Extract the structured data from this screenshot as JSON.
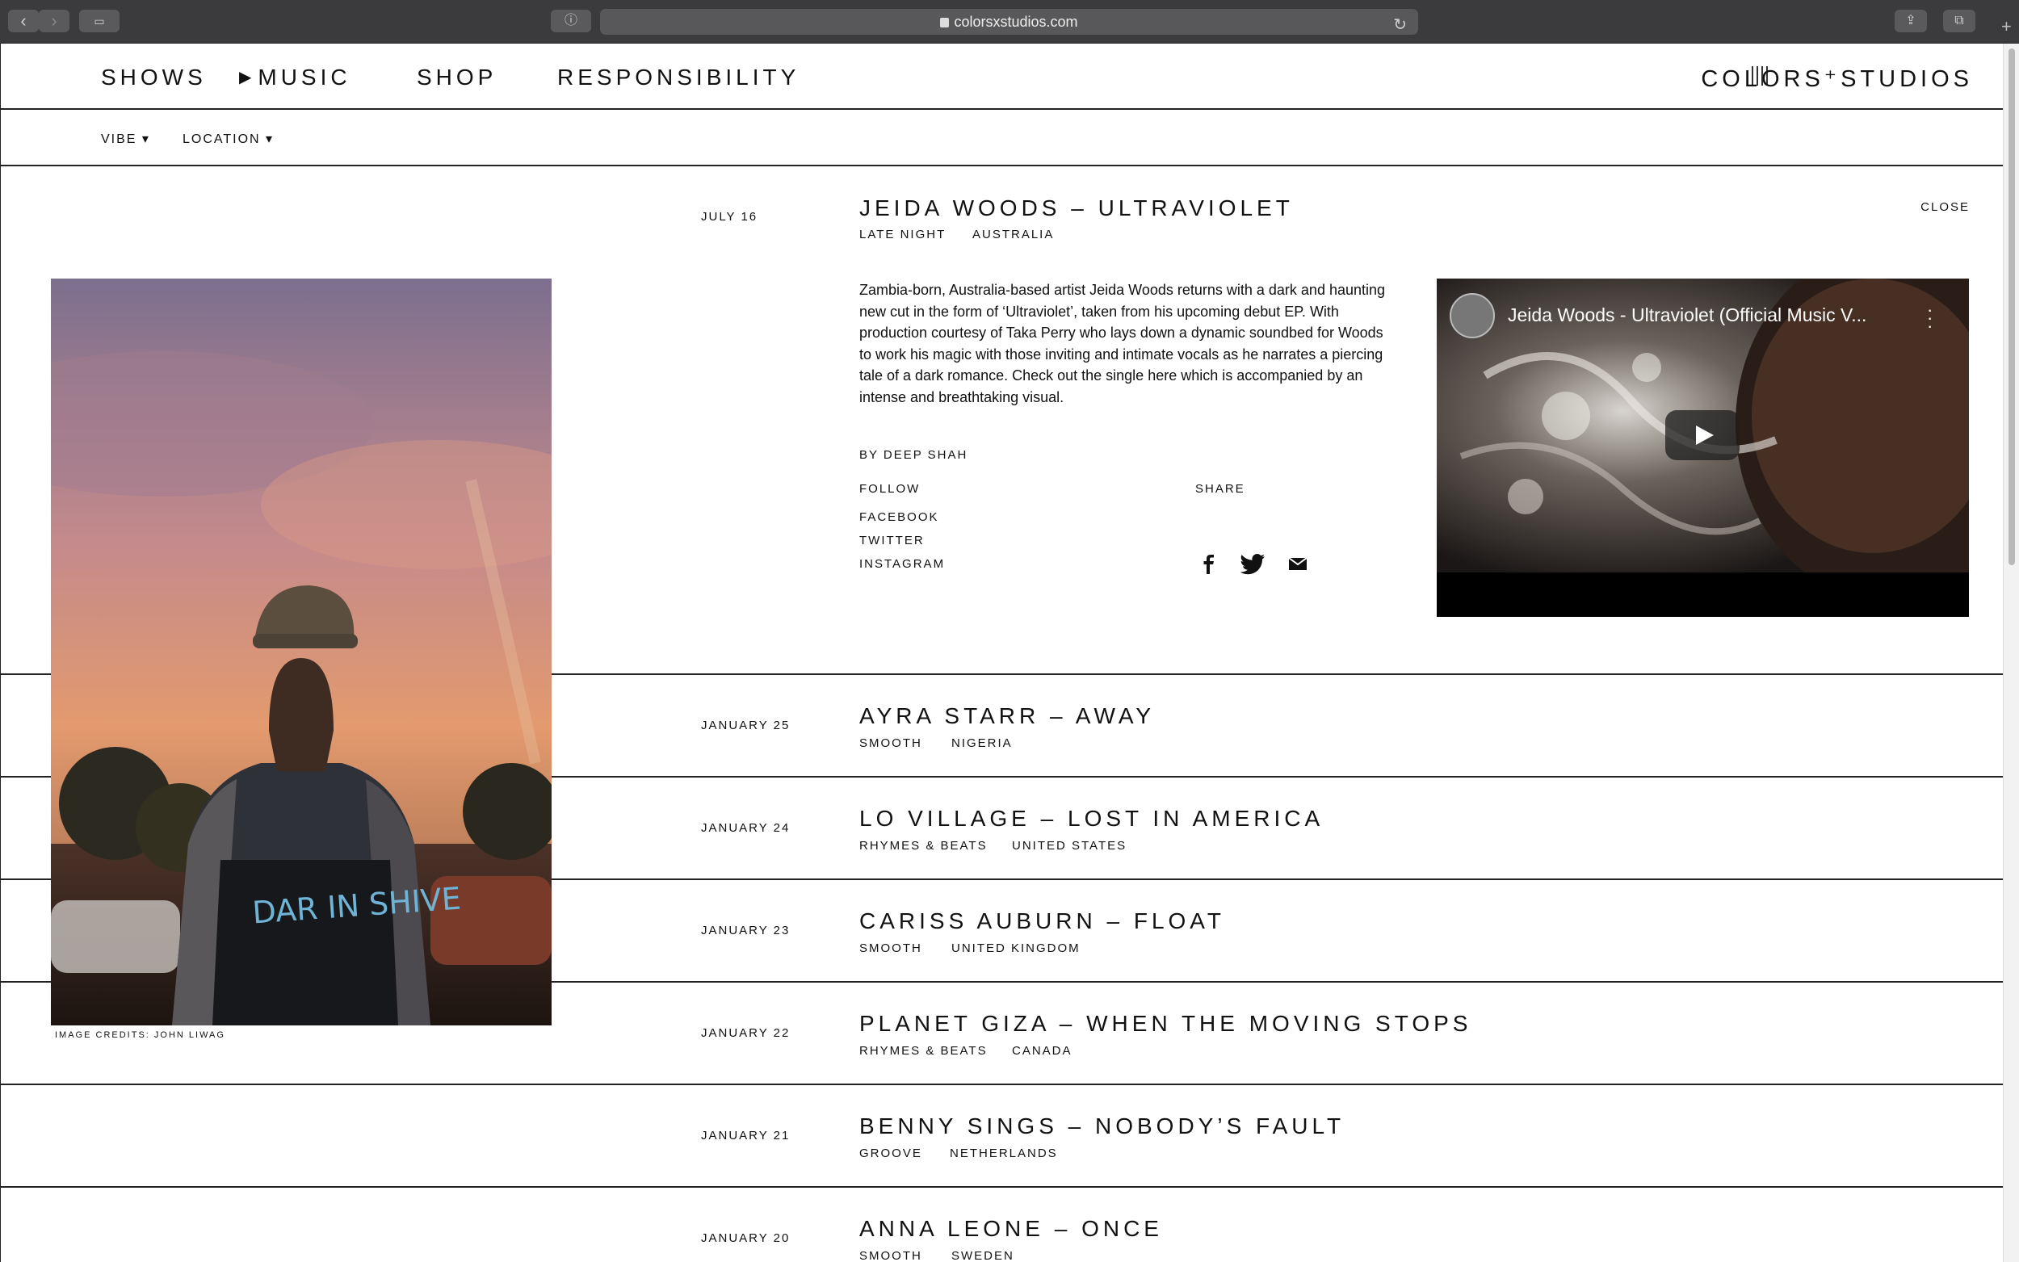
{
  "browser": {
    "url": "colorsxstudios.com",
    "back_icon": "chevron-left-icon",
    "forward_icon": "chevron-right-icon"
  },
  "nav": {
    "items": [
      "SHOWS",
      "MUSIC",
      "SHOP",
      "RESPONSIBILITY"
    ],
    "logo": "COLORS⁺STUDIOS"
  },
  "filters": {
    "vibe": "VIBE ▾",
    "location": "LOCATION ▾"
  },
  "featured": {
    "date": "JULY 16",
    "title": "JEIDA WOODS – ULTRAVIOLET",
    "vibe": "LATE NIGHT",
    "location": "AUSTRALIA",
    "close_label": "CLOSE",
    "description": "Zambia-born, Australia-based artist Jeida Woods returns with a dark and haunting new cut in the form of ‘Ultraviolet’, taken from his upcoming debut EP. With production courtesy of Taka Perry who lays down a dynamic soundbed for Woods to work his magic with those inviting and intimate vocals as he narrates a piercing tale of a dark romance. Check out the single here which is accompanied by an intense and breathtaking visual.",
    "byline": "BY DEEP SHAH",
    "follow_label": "FOLLOW",
    "follow_links": [
      "FACEBOOK",
      "TWITTER",
      "INSTAGRAM"
    ],
    "share_label": "SHARE",
    "image_credit": "IMAGE CREDITS: JOHN LIWAG",
    "video_title": "Jeida Woods - Ultraviolet (Official Music V..."
  },
  "releases": [
    {
      "date": "JANUARY 25",
      "title": "AYRA STARR – AWAY",
      "vibe": "SMOOTH",
      "location": "NIGERIA"
    },
    {
      "date": "JANUARY 24",
      "title": "LO VILLAGE – LOST IN AMERICA",
      "vibe": "RHYMES & BEATS",
      "location": "UNITED STATES"
    },
    {
      "date": "JANUARY 23",
      "title": "CARISS AUBURN – FLOAT",
      "vibe": "SMOOTH",
      "location": "UNITED KINGDOM"
    },
    {
      "date": "JANUARY 22",
      "title": "PLANET GIZA – WHEN THE MOVING STOPS",
      "vibe": "RHYMES & BEATS",
      "location": "CANADA"
    },
    {
      "date": "JANUARY 21",
      "title": "BENNY SINGS – NOBODY’S FAULT",
      "vibe": "GROOVE",
      "location": "NETHERLANDS"
    },
    {
      "date": "JANUARY 20",
      "title": "ANNA LEONE – ONCE",
      "vibe": "SMOOTH",
      "location": "SWEDEN"
    }
  ]
}
